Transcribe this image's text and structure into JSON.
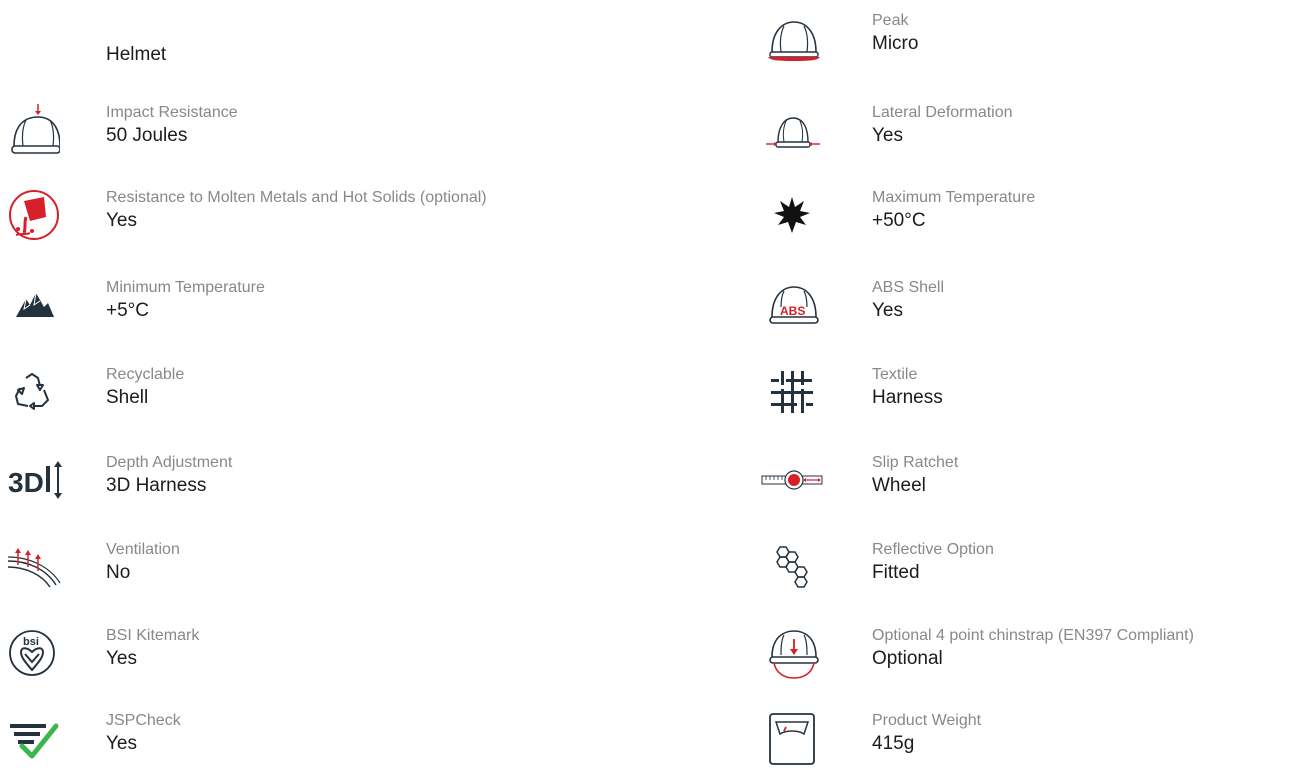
{
  "left": {
    "title": "Helmet",
    "items": [
      {
        "label": "Impact Resistance",
        "value": "50 Joules",
        "icon": "impact-helmet-icon"
      },
      {
        "label": "Resistance to Molten Metals and Hot Solids (optional)",
        "value": "Yes",
        "icon": "molten-metal-icon"
      },
      {
        "label": "Minimum Temperature",
        "value": "+5°C",
        "icon": "mountain-icon"
      },
      {
        "label": "Recyclable",
        "value": "Shell",
        "icon": "recycle-icon"
      },
      {
        "label": "Depth Adjustment",
        "value": "3D Harness",
        "icon": "3d-adjust-icon"
      },
      {
        "label": "Ventilation",
        "value": "No",
        "icon": "ventilation-icon"
      },
      {
        "label": "BSI Kitemark",
        "value": "Yes",
        "icon": "bsi-kitemark-icon",
        "icon_text": "bsi"
      },
      {
        "label": "JSPCheck",
        "value": "Yes",
        "icon": "jspcheck-icon"
      }
    ]
  },
  "right": {
    "items": [
      {
        "label": "Peak",
        "value": "Micro",
        "icon": "peak-helmet-icon"
      },
      {
        "label": "Lateral Deformation",
        "value": "Yes",
        "icon": "lateral-helmet-icon"
      },
      {
        "label": "Maximum Temperature",
        "value": "+50°C",
        "icon": "sun-icon"
      },
      {
        "label": "ABS Shell",
        "value": "Yes",
        "icon": "abs-helmet-icon",
        "icon_text": "ABS"
      },
      {
        "label": "Textile",
        "value": "Harness",
        "icon": "textile-icon"
      },
      {
        "label": "Slip Ratchet",
        "value": "Wheel",
        "icon": "slip-ratchet-icon"
      },
      {
        "label": "Reflective Option",
        "value": "Fitted",
        "icon": "hexagon-icon"
      },
      {
        "label": "Optional 4 point chinstrap (EN397 Compliant)",
        "value": "Optional",
        "icon": "chinstrap-helmet-icon"
      },
      {
        "label": "Product Weight",
        "value": "415g",
        "icon": "scale-icon"
      }
    ]
  },
  "colors": {
    "accent": "#d6202a",
    "icon": "#24323e",
    "label": "#888888",
    "value": "#1c1c1c",
    "check": "#3cb54a"
  }
}
